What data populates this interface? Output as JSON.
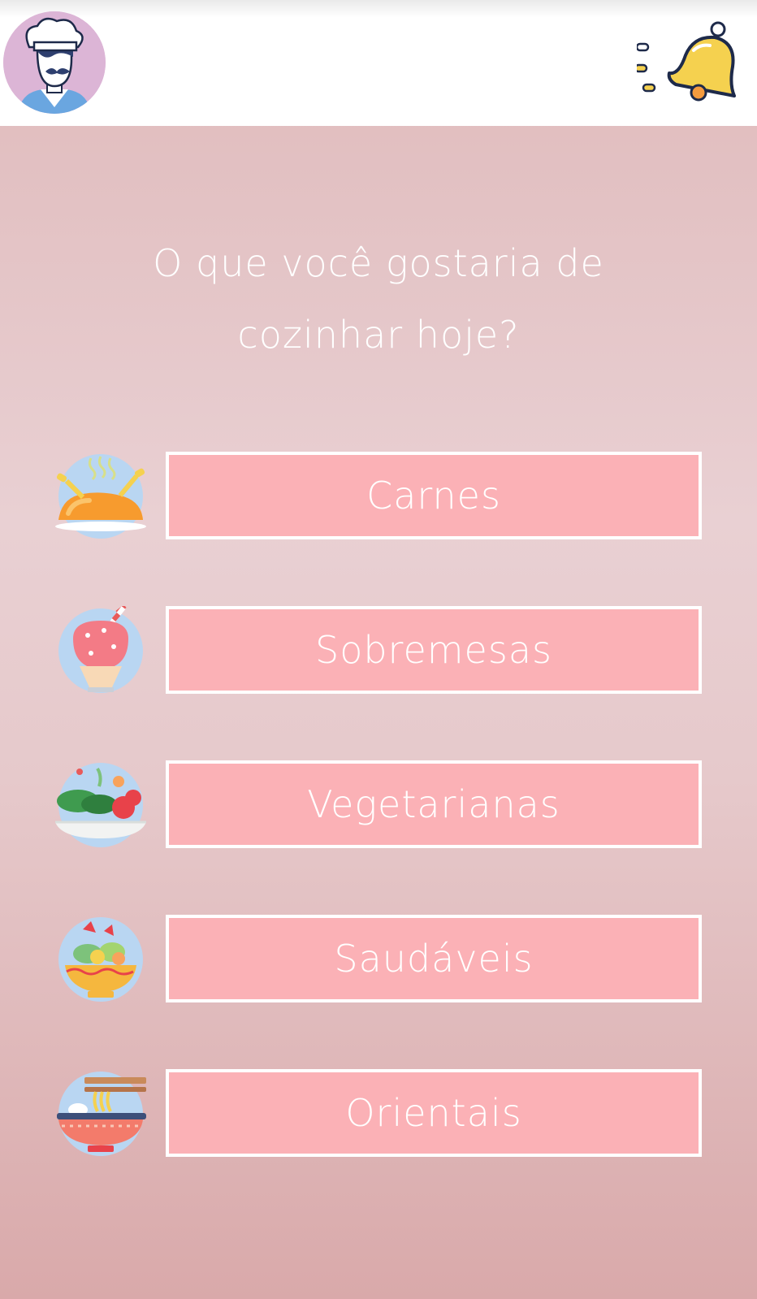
{
  "header": {
    "avatar_icon": "chef-avatar-icon",
    "notification_icon": "bell-icon",
    "accent_color": "#f5d14f"
  },
  "question": {
    "line1": "O que você gostaria de",
    "line2": "cozinhar hoje?"
  },
  "options": [
    {
      "label": "Carnes",
      "icon": "roast-chicken-icon"
    },
    {
      "label": "Sobremesas",
      "icon": "dessert-cup-icon"
    },
    {
      "label": "Vegetarianas",
      "icon": "salad-bowl-icon"
    },
    {
      "label": "Saudáveis",
      "icon": "healthy-bowl-icon"
    },
    {
      "label": "Orientais",
      "icon": "noodle-bowl-icon"
    }
  ],
  "colors": {
    "button_fill": "#fbb1b6",
    "button_border": "#ffffff",
    "text": "#ffffff"
  }
}
